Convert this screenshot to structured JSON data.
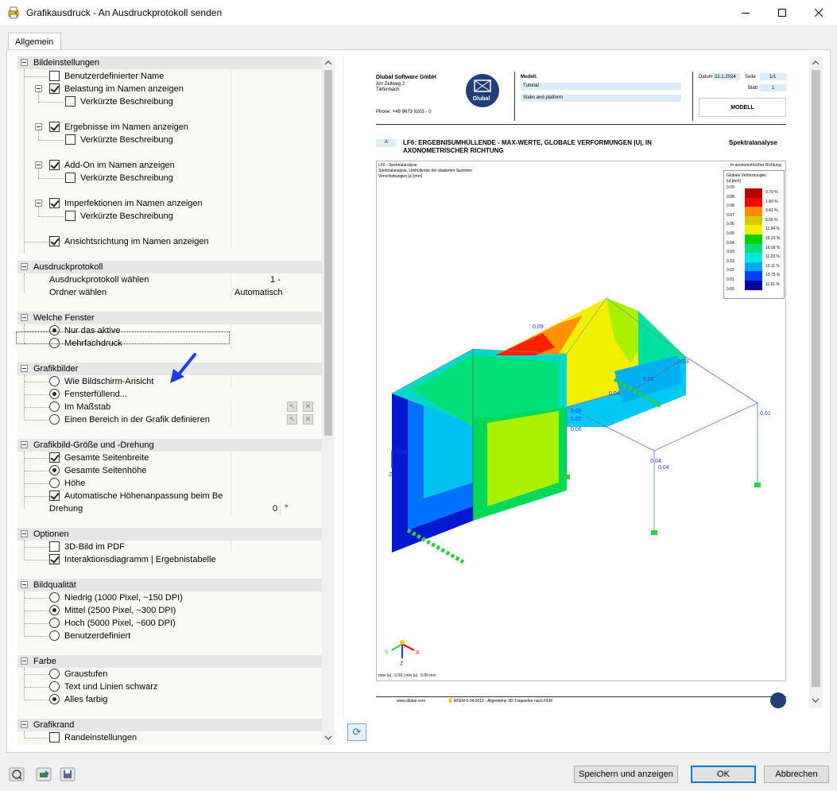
{
  "window": {
    "title": "Grafikausdruck - An Ausdruckprotokoll senden"
  },
  "tabs": [
    {
      "label": "Allgemein"
    }
  ],
  "tree": {
    "bildeinstellungen": {
      "title": "Bildeinstellungen",
      "items": [
        "Benutzerdefinierter Name",
        "Belastung im Namen anzeigen",
        "Verkürzte Beschreibung",
        "Ergebnisse im Namen anzeigen",
        "Verkürzte Beschreibung",
        "Add-On im Namen anzeigen",
        "Verkürzte Beschreibung",
        "Imperfektionen im Namen anzeigen",
        "Verkürzte Beschreibung",
        "Ansichtsrichtung im Namen anzeigen"
      ]
    },
    "ausdruckprotokoll": {
      "title": "Ausdruckprotokoll",
      "rows": [
        {
          "label": "Ausdruckprotokoll wählen",
          "value": "1 -"
        },
        {
          "label": "Ordner wählen",
          "value": "Automatisch"
        }
      ]
    },
    "welche_fenster": {
      "title": "Welche Fenster",
      "items": [
        "Nur das aktive",
        "Mehrfachdruck"
      ]
    },
    "grafikbilder": {
      "title": "Grafikbilder",
      "items": [
        "Wie Bildschirm-Ansicht",
        "Fensterfüllend...",
        "Im Maßstab",
        "Einen Bereich in der Grafik definieren"
      ]
    },
    "groesse": {
      "title": "Grafikbild-Größe und -Drehung",
      "items": [
        "Gesamte Seitenbreite",
        "Gesamte Seitenhöhe",
        "Höhe",
        "Automatische Höhenanpassung beim Be"
      ],
      "rotation": {
        "label": "Drehung",
        "value": "0",
        "unit": "°"
      }
    },
    "optionen": {
      "title": "Optionen",
      "items": [
        "3D-Bild im PDF",
        "Interaktionsdiagramm | Ergebnistabelle"
      ]
    },
    "bildqualitaet": {
      "title": "Bildqualität",
      "items": [
        "Niedrig (1000 Pixel, ~150 DPI)",
        "Mittel (2500 Pixel, ~300 DPI)",
        "Hoch (5000 Pixel, ~600 DPI)",
        "Benutzerdefiniert"
      ]
    },
    "farbe": {
      "title": "Farbe",
      "items": [
        "Graustufen",
        "Text und Linien schwarz",
        "Alles farbig"
      ]
    },
    "grafikrand": {
      "title": "Grafikrand",
      "items": [
        "Randeinstellungen"
      ]
    }
  },
  "preview": {
    "company": "Dlubal Software GmbH",
    "address1": "Am Zellweg 2",
    "address2": "Tiefenbach",
    "phone": "Phone: +49 9673 9203 - 0",
    "logo_text": "Dlubal",
    "modell_label": "Modell:",
    "modell_value1": "Tutorial",
    "modell_value2": "Slabs and platform",
    "datum_label": "Datum",
    "datum_value": "22.1.2024",
    "seite_label": "Seite",
    "seite_value": "1/1",
    "blatt_label": "Blatt",
    "blatt_value": "1",
    "modell_box": "MODELL",
    "section_tag": "A",
    "heading_line1": "LF6: ERGEBNISUMHÜLLENDE - MAX-WERTE, GLOBALE VERFORMUNGEN |U|, IN",
    "heading_line2": "AXONOMETRISCHER RICHTUNG",
    "heading_right": "Spektralanalyse",
    "graphic_line1": "LF6 - Spektralanalyse",
    "graphic_line2": "Spektralanalyse, Umhüllende der skalierten Summen",
    "graphic_line3": "Verschiebungen |u| [mm]",
    "graphic_right": "In axonometrischer Richtung",
    "legend_title": "Globale Verformungen",
    "legend_unit": "|u| [mm]",
    "legend_values": [
      "0.09",
      "0.08",
      "0.08",
      "0.07",
      "0.06",
      "0.05",
      "0.04",
      "0.03",
      "0.03",
      "0.02",
      "0.01",
      "0.00"
    ],
    "legend_percents": [
      "0.79 %",
      "1.80 %",
      "3.41 %",
      "5.56 %",
      "11.94 %",
      "16.23 %",
      "16.58 %",
      "11.23 %",
      "10.11 %",
      "10.75 %",
      "11.61 %"
    ],
    "legend_colors": [
      "#b00000",
      "#ff0000",
      "#ff8c00",
      "#d7c800",
      "#f0f000",
      "#00d000",
      "#00e07a",
      "#00e8d8",
      "#00a8ff",
      "#0040ff",
      "#0000a0"
    ],
    "labels": [
      "0.09",
      "0.05",
      "0.05",
      "0.06",
      "0.04",
      "0.03",
      "0.03",
      "0.01",
      "0.04",
      "0.04",
      "0.00"
    ],
    "footer_minmax": "max |u| : 0.09 | min |u| : 0.00 mm",
    "footer_web": "www.dlubal.com",
    "footer_program": "RFEM 6.04.0012 - Allgemeine 3D-Tragwerke nach FEM"
  },
  "buttons": {
    "save_show": "Speichern und anzeigen",
    "ok": "OK",
    "cancel": "Abbrechen"
  }
}
